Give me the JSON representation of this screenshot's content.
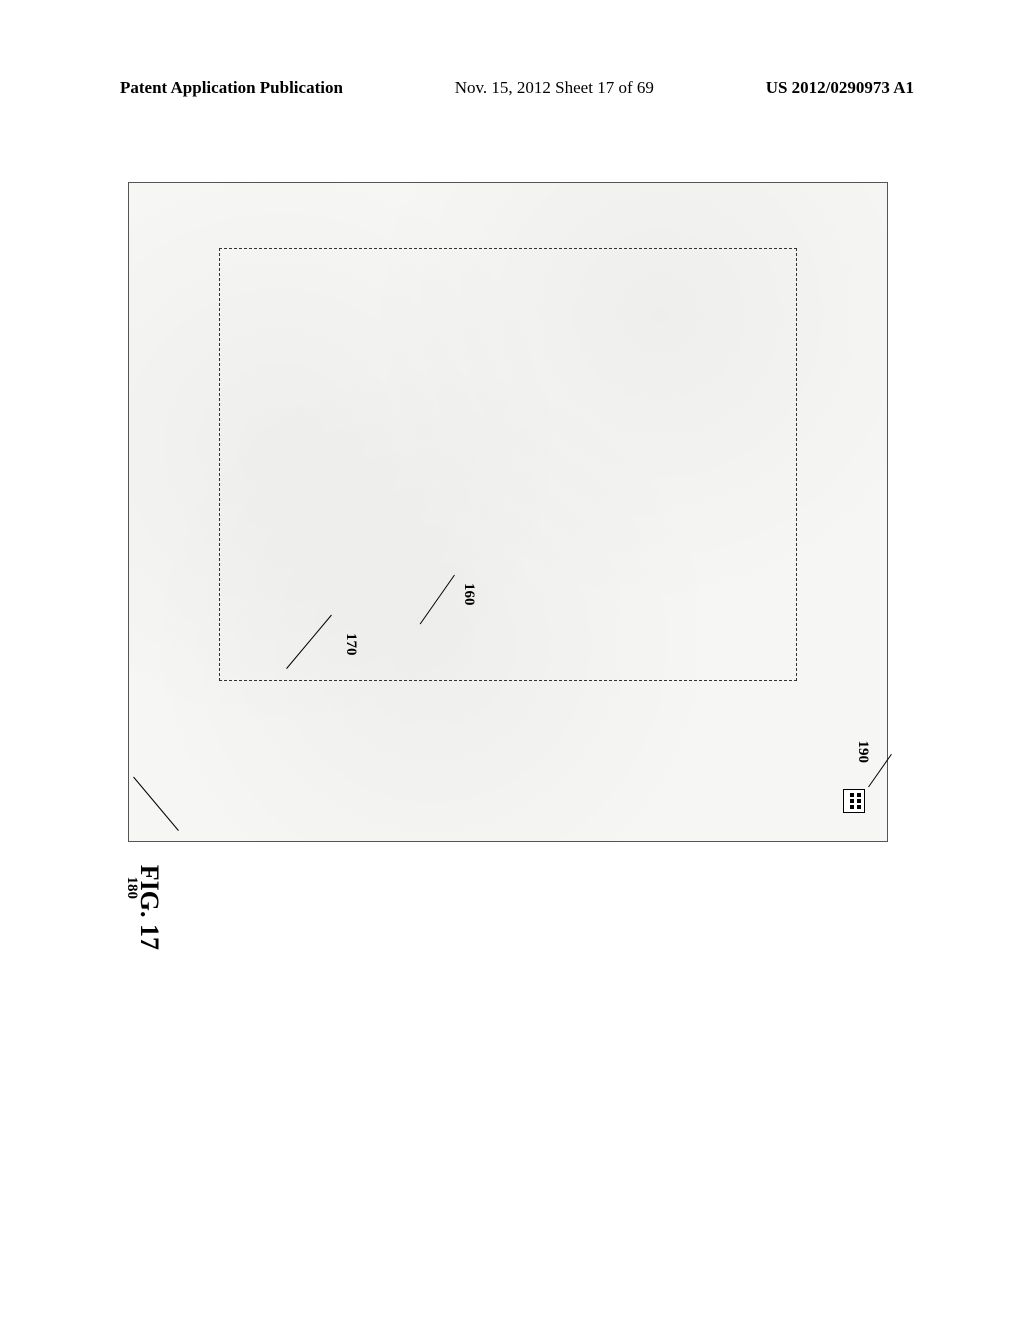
{
  "header": {
    "left": "Patent Application Publication",
    "center": "Nov. 15, 2012  Sheet 17 of 69",
    "right": "US 2012/0290973 A1"
  },
  "figure": {
    "caption": "FIG. 17",
    "refs": {
      "r190": "190",
      "r160": "160",
      "r170": "170",
      "r180": "180"
    }
  }
}
